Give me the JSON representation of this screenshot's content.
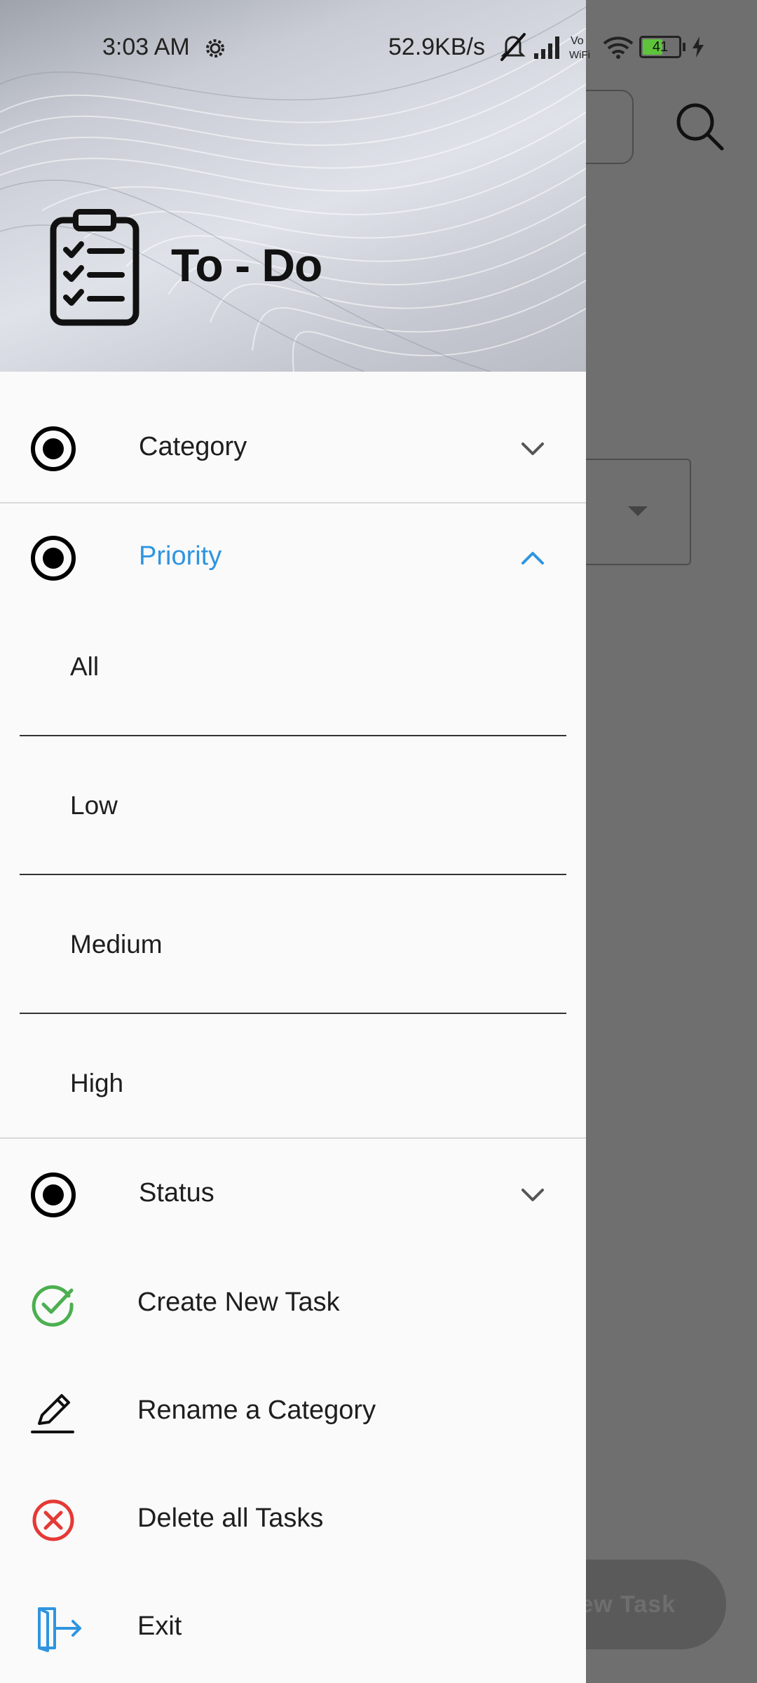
{
  "status_bar": {
    "time": "3:03 AM",
    "network_speed": "52.9KB/s",
    "battery_level": "41",
    "icons": [
      "settings-gear-icon",
      "mute-icon",
      "signal-icon",
      "vowifi-icon",
      "wifi-icon",
      "battery-icon",
      "charging-icon"
    ]
  },
  "drawer": {
    "header": {
      "title": "To - Do",
      "logo": "clipboard-checklist-icon"
    },
    "sections": {
      "category": {
        "label": "Category",
        "expanded": false,
        "icon": "radio-selected-icon"
      },
      "priority": {
        "label": "Priority",
        "expanded": true,
        "icon": "radio-selected-icon",
        "items": [
          "All",
          "Low",
          "Medium",
          "High"
        ]
      },
      "status": {
        "label": "Status",
        "expanded": false,
        "icon": "radio-selected-icon"
      }
    },
    "actions": {
      "create": {
        "label": "Create New Task",
        "icon": "check-circle-icon"
      },
      "rename": {
        "label": "Rename a Category",
        "icon": "pencil-icon"
      },
      "delete": {
        "label": "Delete all Tasks",
        "icon": "cancel-circle-icon"
      },
      "exit": {
        "label": "Exit",
        "icon": "exit-door-icon"
      }
    }
  },
  "background": {
    "fab_label": "New Task"
  },
  "colors": {
    "accent": "#2f95e0",
    "success": "#4caf50",
    "danger": "#e53935",
    "scrim": "#6f6f6f"
  }
}
